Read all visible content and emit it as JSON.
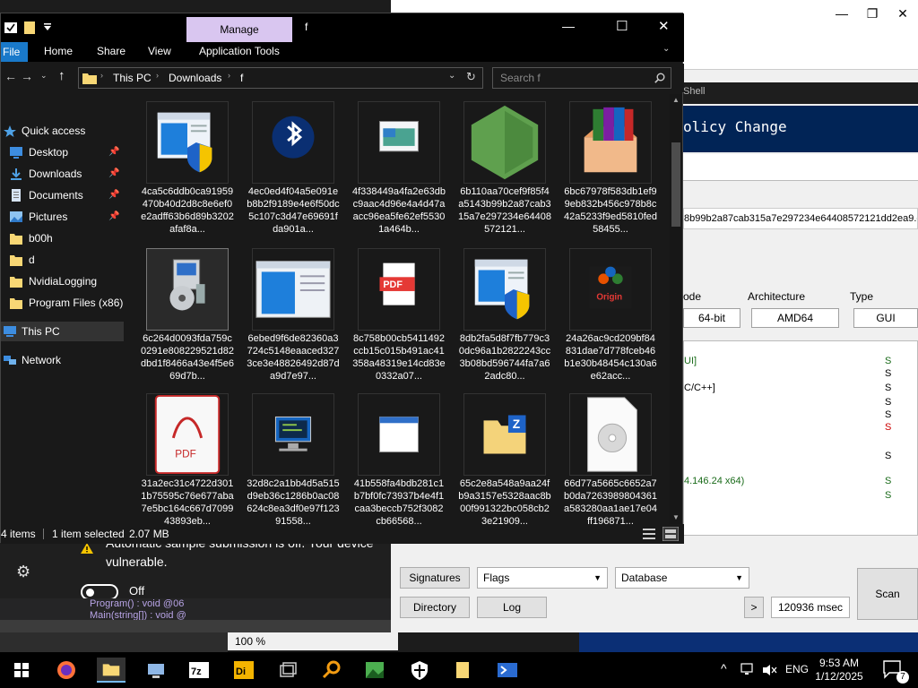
{
  "background_app": {
    "shell_label": "Shell",
    "banner_text": "olicy Change",
    "hash_text": "8b99b2a87cab315a7e297234e64408572121dd2ea9.e",
    "labels": {
      "mode": "ode",
      "architecture": "Architecture",
      "type": "Type"
    },
    "fields": {
      "bits": "64-bit",
      "arch": "AMD64",
      "type": "GUI"
    },
    "results": [
      {
        "text": "UI]",
        "flag": "S",
        "flag_color": "#1a6b1a"
      },
      {
        "text": "",
        "flag": "S",
        "flag_color": "#000000"
      },
      {
        "text": "C/C++]",
        "flag": "S",
        "flag_color": "#000000"
      },
      {
        "text": "",
        "flag": "S",
        "flag_color": "#000000"
      },
      {
        "text": "",
        "flag": "S",
        "flag_color": "#000000"
      },
      {
        "text": "",
        "flag": "S",
        "flag_color": "#cc0000"
      },
      {
        "text": "",
        "flag": "S",
        "flag_color": "#000000"
      },
      {
        "text": "4.146.24 x64)",
        "flag": "S",
        "flag_color": "#1a6b1a"
      },
      {
        "text": "",
        "flag": "S",
        "flag_color": "#1a6b1a"
      }
    ],
    "buttons": {
      "signatures": "Signatures",
      "flags": "Flags",
      "database": "Database",
      "directory": "Directory",
      "log": "Log",
      "more": ">",
      "time": "120936 msec",
      "scan": "Scan"
    },
    "win_controls": {
      "minimize": "—",
      "restore": "❐",
      "close": "✕"
    }
  },
  "defender": {
    "warning_line1": "Automatic sample submission is off. Your device",
    "warning_line2": "vulnerable.",
    "toggle_label": "Off"
  },
  "vs": {
    "line1": "Program() : void @06",
    "line2": "Main(string[]) : void @"
  },
  "zoom": "100 %",
  "explorer": {
    "title": "f",
    "tabs": {
      "file": "File",
      "home": "Home",
      "share": "Share",
      "view": "View",
      "manage": "Manage",
      "app_tools": "Application Tools"
    },
    "window_controls": {
      "minimize": "—",
      "maximize": "☐",
      "close": "✕"
    },
    "breadcrumb": [
      "This PC",
      "Downloads",
      "f"
    ],
    "search_placeholder": "Search f",
    "nav": [
      {
        "label": "Quick access",
        "icon": "star-icon",
        "pinned": false,
        "selected": false
      },
      {
        "label": "Desktop",
        "icon": "desktop-icon",
        "pinned": true,
        "selected": false
      },
      {
        "label": "Downloads",
        "icon": "download-icon",
        "pinned": true,
        "selected": false
      },
      {
        "label": "Documents",
        "icon": "documents-icon",
        "pinned": true,
        "selected": false
      },
      {
        "label": "Pictures",
        "icon": "pictures-icon",
        "pinned": true,
        "selected": false
      },
      {
        "label": "b00h",
        "icon": "folder-icon",
        "pinned": false,
        "selected": false
      },
      {
        "label": "d",
        "icon": "folder-icon",
        "pinned": false,
        "selected": false
      },
      {
        "label": "NvidiaLogging",
        "icon": "folder-icon",
        "pinned": false,
        "selected": false
      },
      {
        "label": "Program Files (x86)",
        "icon": "folder-icon",
        "pinned": false,
        "selected": false
      },
      {
        "label": "This PC",
        "icon": "pc-icon",
        "pinned": false,
        "selected": true
      },
      {
        "label": "Network",
        "icon": "network-icon",
        "pinned": false,
        "selected": false
      }
    ],
    "files": [
      {
        "name": "4ca5c6ddb0ca91959470b40d2d8c8e6ef0e2adff63b6d89b3202afaf8a...",
        "icon": "uac-app-icon",
        "selected": false
      },
      {
        "name": "4ec0ed4f04a5e091eb8b2f9189e4e6f50dc5c107c3d47e69691fda901a...",
        "icon": "bluetooth-icon",
        "selected": false
      },
      {
        "name": "4f338449a4fa2e63dbc9aac4d96e4a4d47aacc96ea5fe62ef55301a464b...",
        "icon": "control-panel-icon",
        "selected": false
      },
      {
        "name": "6b110aa70cef9f85f4a5143b99b2a87cab315a7e297234e64408572121...",
        "icon": "nodejs-icon",
        "selected": false
      },
      {
        "name": "6bc67978f583db1ef99eb832b456c978b8c42a5233f9ed5810fed58455...",
        "icon": "winrar-icon",
        "selected": false
      },
      {
        "name": "6c264d0093fda759c0291e808229521d82dbd1f8466a43e4f5e669d7b...",
        "icon": "installer-icon",
        "selected": true
      },
      {
        "name": "6ebed9f6de82360a3724c5148eaaced3273ce3e48826492d87da9d7e97...",
        "icon": "window-app-icon",
        "selected": false
      },
      {
        "name": "8c758b00cb5411492ccb15c015b491ac41358a48319e14cd83e0332a07...",
        "icon": "pdf-icon",
        "selected": false
      },
      {
        "name": "8db2fa5d8f7fb779c30dc96a1b2822243cc3b08bd596744fa7a62adc80...",
        "icon": "uac-app-icon",
        "selected": false
      },
      {
        "name": "24a26ac9cd209bf84831dae7d778fceb46b1e30b48454c130a6e62acc...",
        "icon": "origin-icon",
        "selected": false
      },
      {
        "name": "31a2ec31c4722d3011b75595c76e677aba7e5bc164c667d709943893eb...",
        "icon": "pdf-reader-icon",
        "selected": false
      },
      {
        "name": "32d8c2a1bb4d5a515d9eb36c1286b0ac08624c8ea3df0e97f12391558...",
        "icon": "network-pc-icon",
        "selected": false
      },
      {
        "name": "41b558fa4bdb281c1b7bf0fc73937b4e4f1caa3beccb752f3082cb66568...",
        "icon": "window-icon",
        "selected": false
      },
      {
        "name": "65c2e8a548a9aa24fb9a3157e5328aac8b00f991322bc058cb23e21909...",
        "icon": "zip-folder-icon",
        "selected": false
      },
      {
        "name": "66d77a5665c6652a7b0da7263989804361a583280aa1ae17e04ff196871...",
        "icon": "disc-file-icon",
        "selected": false
      }
    ],
    "status": {
      "items": "4 items",
      "selected": "1 item selected",
      "size": "2.07 MB"
    }
  },
  "taskbar": {
    "icons": [
      "windows-start-icon",
      "firefox-icon",
      "file-explorer-icon",
      "network-app-icon",
      "7zip-icon",
      "die-icon",
      "windows-icon",
      "search-app-icon",
      "photo-icon",
      "security-icon",
      "folder-icon",
      "powershell-icon"
    ],
    "language": "ENG",
    "time": "9:53 AM",
    "date": "1/12/2025",
    "notification_count": "7"
  }
}
